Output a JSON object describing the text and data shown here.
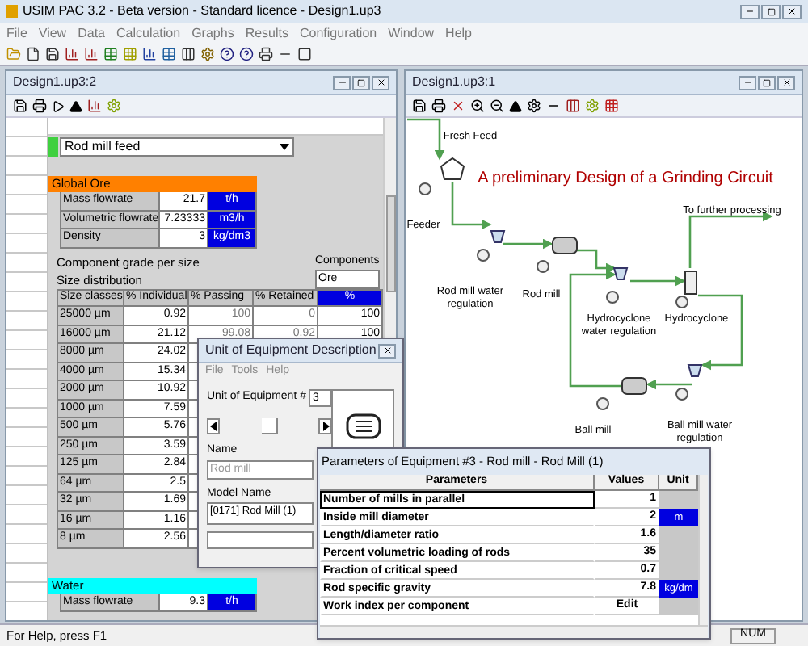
{
  "window": {
    "title": "USIM PAC 3.2 - Beta version - Standard licence - Design1.up3"
  },
  "menu": [
    "File",
    "View",
    "Data",
    "Calculation",
    "Graphs",
    "Results",
    "Configuration",
    "Window",
    "Help"
  ],
  "data_window": {
    "title": "Design1.up3:2",
    "stream": "Rod mill feed",
    "global_ore": {
      "title": "Global Ore",
      "rows": [
        {
          "label": "Mass flowrate",
          "value": "21.7",
          "unit": "t/h"
        },
        {
          "label": "Volumetric flowrate",
          "value": "7.23333",
          "unit": "m3/h"
        },
        {
          "label": "Density",
          "value": "3",
          "unit": "kg/dm3"
        }
      ]
    },
    "grade_label": "Component grade per size",
    "components_label": "Components",
    "size_label": "Size distribution",
    "component": "Ore",
    "columns": [
      "Size classes",
      "% Individual",
      "% Passing",
      "% Retained",
      "%"
    ],
    "rows": [
      {
        "size": "25000 µm",
        "individual": "0.92",
        "passing": "100",
        "retained": "0",
        "pct": "100"
      },
      {
        "size": "16000 µm",
        "individual": "21.12",
        "passing": "99.08",
        "retained": "0.92",
        "pct": "100"
      },
      {
        "size": "8000 µm",
        "individual": "24.02"
      },
      {
        "size": "4000 µm",
        "individual": "15.34"
      },
      {
        "size": "2000 µm",
        "individual": "10.92"
      },
      {
        "size": "1000 µm",
        "individual": "7.59"
      },
      {
        "size": "500 µm",
        "individual": "5.76"
      },
      {
        "size": "250 µm",
        "individual": "3.59"
      },
      {
        "size": "125 µm",
        "individual": "2.84"
      },
      {
        "size": "64 µm",
        "individual": "2.5"
      },
      {
        "size": "32 µm",
        "individual": "1.69"
      },
      {
        "size": "16 µm",
        "individual": "1.16"
      },
      {
        "size": "8 µm",
        "individual": "2.56"
      }
    ],
    "water": {
      "title": "Water",
      "rows": [
        {
          "label": "Mass flowrate",
          "value": "9.3",
          "unit": "t/h"
        }
      ]
    }
  },
  "diagram_window": {
    "title": "Design1.up3:1",
    "heading": "A preliminary Design of a Grinding Circuit",
    "labels": [
      "Fresh Feed",
      "To further processing",
      "Feeder",
      "Rod mill water regulation",
      "Rod mill",
      "Hydrocyclone water regulation",
      "Hydrocyclone",
      "Ball mill",
      "Ball mill water regulation"
    ]
  },
  "unit_dialog": {
    "title": "Unit of Equipment Description",
    "menu": [
      "File",
      "Tools",
      "Help"
    ],
    "number_label": "Unit of Equipment #",
    "number": "3",
    "name_label": "Name",
    "name": "Rod mill",
    "name_disabled": true,
    "model_label": "Model Name",
    "model": "[0171] Rod Mill (1)"
  },
  "params_dialog": {
    "title": "Parameters of Equipment #3 - Rod mill - Rod Mill (1)",
    "columns": [
      "Parameters",
      "Values",
      "Unit"
    ],
    "rows": [
      {
        "name": "Number of mills in parallel",
        "value": "1",
        "selected": true
      },
      {
        "name": "Inside mill diameter",
        "value": "2",
        "unit": "m",
        "selected": false
      },
      {
        "name": "Length/diameter ratio",
        "value": "1.6",
        "selected": false
      },
      {
        "name": "Percent volumetric loading of rods",
        "value": "35",
        "selected": false
      },
      {
        "name": "Fraction of critical speed",
        "value": "0.7",
        "selected": false
      },
      {
        "name": "Rod specific gravity",
        "value": "7.8",
        "unit": "kg/dm",
        "selected": false
      },
      {
        "name": "Work index per component",
        "value": "Edit",
        "selected": false
      }
    ]
  },
  "status_bar": {
    "text": "For Help, press F1",
    "indicator": "NUM"
  }
}
